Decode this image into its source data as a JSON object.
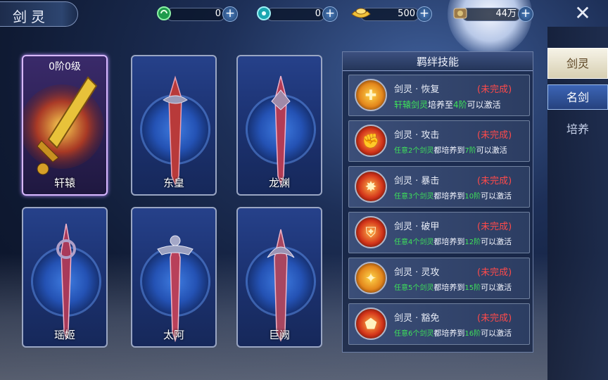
{
  "header": {
    "title": "剑灵"
  },
  "resources": [
    {
      "icon": "green-orb-icon",
      "value": "0"
    },
    {
      "icon": "teal-orb-icon",
      "value": "0"
    },
    {
      "icon": "gold-ingot-icon",
      "value": "500"
    },
    {
      "icon": "coin-bag-icon",
      "value": "44万"
    }
  ],
  "cards": [
    {
      "name": "轩辕",
      "rank": "0阶0级",
      "selected": true
    },
    {
      "name": "东皇"
    },
    {
      "name": "龙渊"
    },
    {
      "name": "瑶姬"
    },
    {
      "name": "太阿"
    },
    {
      "name": "巨阙"
    }
  ],
  "bond_panel": {
    "title": "羁绊技能",
    "skills": [
      {
        "name": "剑灵 · 恢复",
        "status": "(未完成)",
        "desc": [
          [
            "g",
            "轩辕剑灵"
          ],
          [
            "w",
            "培养至"
          ],
          [
            "g",
            "4阶"
          ],
          [
            "w",
            "可以激活"
          ]
        ]
      },
      {
        "name": "剑灵 · 攻击",
        "status": "(未完成)",
        "desc": [
          [
            "g",
            "任意2个剑灵"
          ],
          [
            "w",
            "都培养到"
          ],
          [
            "g",
            "7阶"
          ],
          [
            "w",
            "可以激活"
          ]
        ]
      },
      {
        "name": "剑灵 · 暴击",
        "status": "(未完成)",
        "desc": [
          [
            "g",
            "任意3个剑灵"
          ],
          [
            "w",
            "都培养到"
          ],
          [
            "g",
            "10阶"
          ],
          [
            "w",
            "可以激活"
          ]
        ]
      },
      {
        "name": "剑灵 · 破甲",
        "status": "(未完成)",
        "desc": [
          [
            "g",
            "任意4个剑灵"
          ],
          [
            "w",
            "都培养到"
          ],
          [
            "g",
            "12阶"
          ],
          [
            "w",
            "可以激活"
          ]
        ]
      },
      {
        "name": "剑灵 · 灵攻",
        "status": "(未完成)",
        "desc": [
          [
            "g",
            "任意5个剑灵"
          ],
          [
            "w",
            "都培养到"
          ],
          [
            "g",
            "15阶"
          ],
          [
            "w",
            "可以激活"
          ]
        ]
      },
      {
        "name": "剑灵 · 豁免",
        "status": "(未完成)",
        "desc": [
          [
            "g",
            "任意6个剑灵"
          ],
          [
            "w",
            "都培养到"
          ],
          [
            "g",
            "16阶"
          ],
          [
            "w",
            "可以激活"
          ]
        ]
      }
    ]
  },
  "tabs": [
    "剑灵",
    "名剑",
    "培养"
  ],
  "colors": {
    "status_incomplete": "#ff4a4a",
    "highlight_green": "#3ee25a"
  }
}
